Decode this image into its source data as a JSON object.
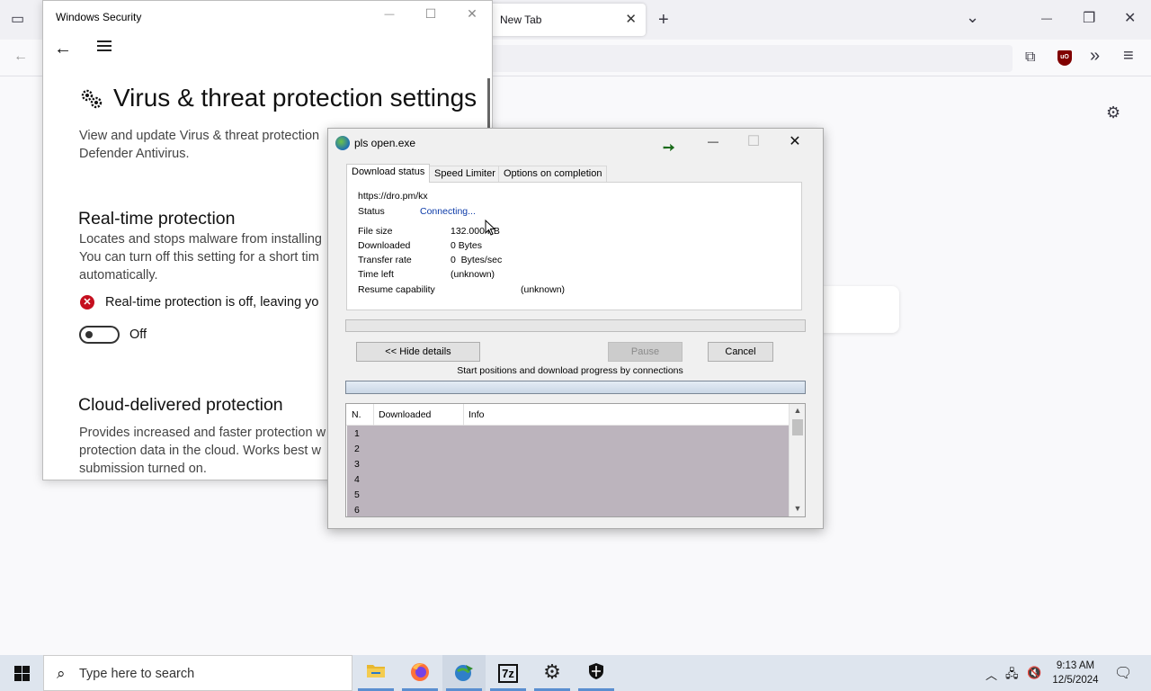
{
  "firefox": {
    "tab_title": "New Tab",
    "tab_close": "✕",
    "new_tab": "+",
    "list_all_tabs": "⌄",
    "minimize": "—",
    "restore": "❐",
    "close": "✕",
    "back": "←",
    "ublock_label": "uO",
    "overflow": "»",
    "menu": "≡",
    "settings": "⚙"
  },
  "windows_security": {
    "window_title": "Windows Security",
    "minimize": "—",
    "maximize": "☐",
    "close": "✕",
    "back": "←",
    "page_title": "Virus & threat protection settings",
    "intro_line1": "View and update Virus & threat protection",
    "intro_line2": "Defender Antivirus.",
    "realtime_heading": "Real-time protection",
    "realtime_desc_line1": "Locates and stops malware from installing",
    "realtime_desc_line2": "You can turn off this setting for a short tim",
    "realtime_desc_line3": "automatically.",
    "realtime_warning": "Real-time protection is off, leaving yo",
    "toggle_state": "Off",
    "cloud_heading": "Cloud-delivered protection",
    "cloud_desc_line1": "Provides increased and faster protection w",
    "cloud_desc_line2": "protection data in the cloud. Works best w",
    "cloud_desc_line3": "submission turned on."
  },
  "idm_dialog": {
    "title": "pls open.exe",
    "minimize": "—",
    "maximize": "☐",
    "close": "✕",
    "tabs": [
      "Download status",
      "Speed Limiter",
      "Options on completion"
    ],
    "url": "https://dro.pm/kx",
    "status_label": "Status",
    "status_value": "Connecting...",
    "file_size_label": "File size",
    "file_size_value": "132.000 KB",
    "downloaded_label": "Downloaded",
    "downloaded_value": "0 Bytes",
    "transfer_rate_label": "Transfer rate",
    "transfer_rate_value": "0  Bytes/sec",
    "time_left_label": "Time left",
    "time_left_value": "(unknown)",
    "resume_label": "Resume capability",
    "resume_value": "(unknown)",
    "progress_fraction": 0,
    "hide_details_button": "<< Hide details",
    "pause_button": "Pause",
    "cancel_button": "Cancel",
    "connections_label": "Start positions and download progress by connections",
    "columns": [
      "N.",
      "Downloaded",
      "Info"
    ],
    "rows": [
      "1",
      "2",
      "3",
      "4",
      "5",
      "6"
    ]
  },
  "taskbar": {
    "search_placeholder": "Type here to search",
    "apps": [
      "file-explorer",
      "firefox",
      "internet-download-manager",
      "7-zip",
      "settings",
      "windows-security"
    ],
    "sevenzip_label": "7z",
    "time": "9:13 AM",
    "date": "12/5/2024"
  }
}
